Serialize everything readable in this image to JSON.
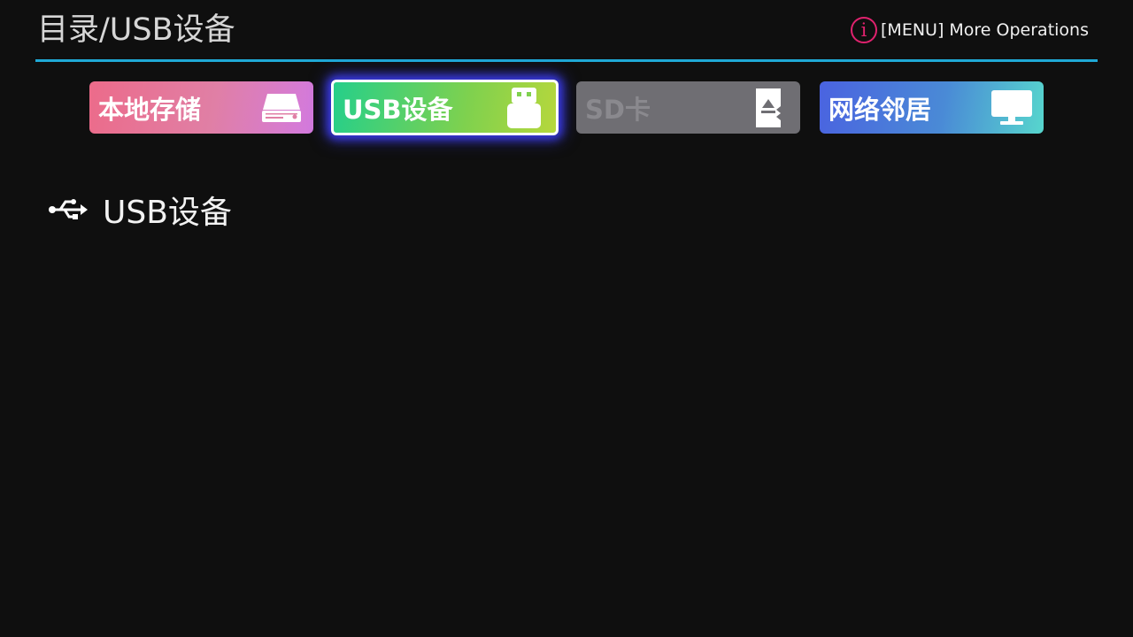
{
  "header": {
    "title": "目录/USB设备",
    "menu_hint": "[MENU] More Operations",
    "info_icon_glyph": "i",
    "accent_color": "#1fa9d6",
    "info_color": "#e0226e"
  },
  "tabs": [
    {
      "label": "本地存储",
      "icon": "hard-drive-icon",
      "selected": false
    },
    {
      "label": "USB设备",
      "icon": "usb-stick-icon",
      "selected": true
    },
    {
      "label": "SD卡",
      "icon": "sd-card-icon",
      "selected": false,
      "disabled": true
    },
    {
      "label": "网络邻居",
      "icon": "monitor-icon",
      "selected": false
    }
  ],
  "list": {
    "items": [
      {
        "label": "USB设备",
        "icon": "usb-symbol-icon"
      }
    ]
  }
}
